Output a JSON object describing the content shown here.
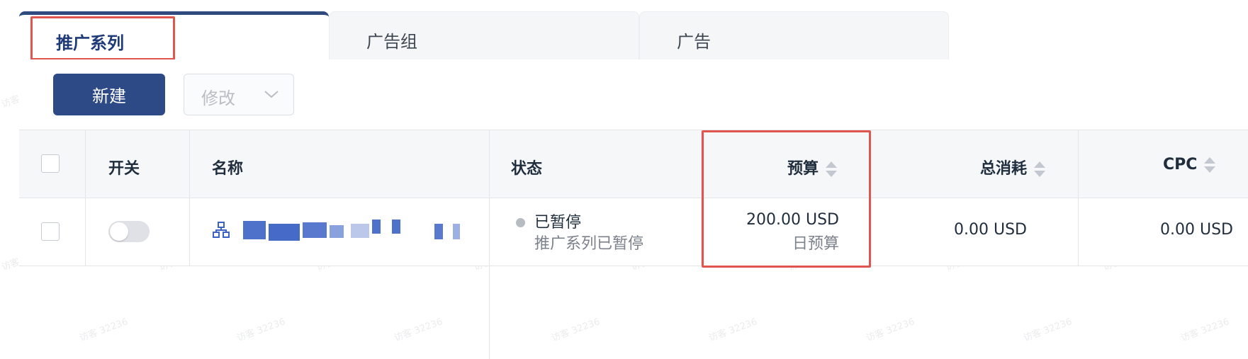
{
  "tabs": [
    {
      "label": "推广系列",
      "active": true
    },
    {
      "label": "广告组",
      "active": false
    },
    {
      "label": "广告",
      "active": false
    }
  ],
  "toolbar": {
    "new_label": "新建",
    "edit_label": "修改"
  },
  "table": {
    "headers": {
      "switch": "开关",
      "name": "名称",
      "status": "状态",
      "budget": "预算",
      "total_spend": "总消耗",
      "cpc": "CPC"
    },
    "rows": [
      {
        "switch_on": false,
        "name": "",
        "status": "已暂停",
        "status_detail": "推广系列已暂停",
        "budget": "200.00 USD",
        "budget_type": "日预算",
        "total_spend": "0.00 USD",
        "cpc": "0.00 USD"
      }
    ]
  },
  "watermark": "访客 32236",
  "colors": {
    "accent": "#2e4a86",
    "highlight": "#e0554f",
    "name_link": "#3b62c4"
  }
}
